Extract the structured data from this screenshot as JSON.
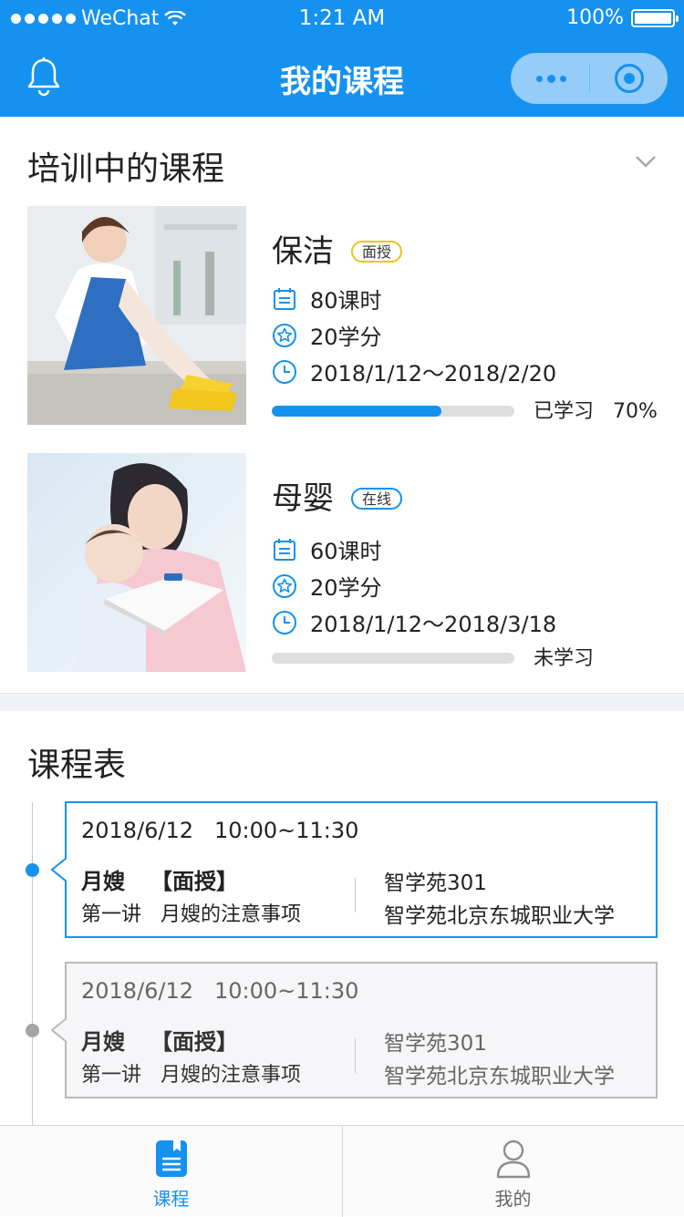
{
  "status_bar": {
    "carrier": "WeChat",
    "time": "1:21 AM",
    "battery": "100%"
  },
  "nav": {
    "title": "我的课程",
    "left_icon": "bell-icon",
    "capsule_icons": [
      "more-dots-icon",
      "close-target-icon"
    ]
  },
  "training": {
    "title": "培训中的课程",
    "collapse_icon": "chevron-down-icon",
    "courses": [
      {
        "name": "保洁",
        "tag": "面授",
        "tag_color": "#f3c11a",
        "hours": "80课时",
        "credits": "20学分",
        "period": "2018/1/12～2018/2/20",
        "progress": 0.7,
        "progress_text": "已学习   70%",
        "image": "cleaning-photo"
      },
      {
        "name": "母婴",
        "tag": "在线",
        "tag_color": "#1591f0",
        "hours": "60课时",
        "credits": "20学分",
        "period": "2018/1/12～2018/3/18",
        "progress": 0,
        "progress_text": "未学习",
        "image": "mother-baby-photo"
      }
    ]
  },
  "schedule": {
    "title": "课程表",
    "items": [
      {
        "datetime": "2018/6/12   10:00~11:30",
        "course": "月嫂",
        "type": "【面授】",
        "lecture": "第一讲   月嫂的注意事项",
        "room": "智学苑301",
        "school": "智学苑北京东城职业大学",
        "active": true
      },
      {
        "datetime": "2018/6/12   10:00~11:30",
        "course": "月嫂",
        "type": "【面授】",
        "lecture": "第一讲   月嫂的注意事项",
        "room": "智学苑301",
        "school": "智学苑北京东城职业大学",
        "active": false
      }
    ]
  },
  "tabbar": {
    "tabs": [
      {
        "label": "课程",
        "icon": "course-book-icon",
        "active": true
      },
      {
        "label": "我的",
        "icon": "user-profile-icon",
        "active": false
      }
    ]
  },
  "colors": {
    "brand": "#1591f0",
    "tag_yellow": "#f3c11a",
    "inactive_gray": "#a5a5a5"
  }
}
